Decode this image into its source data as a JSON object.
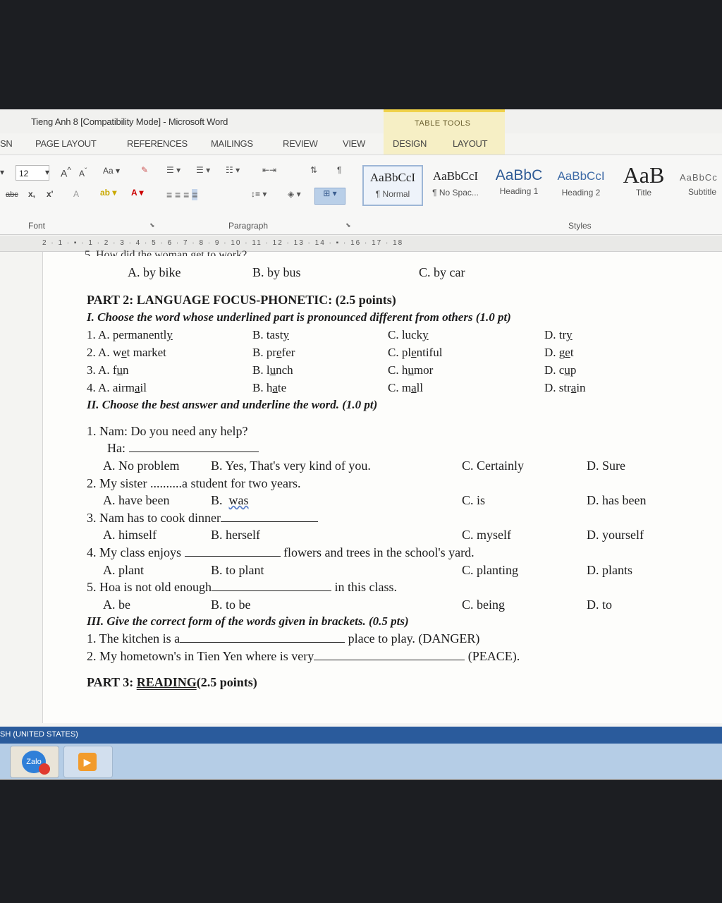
{
  "window": {
    "title": "Tieng Anh 8 [Compatibility Mode] - Microsoft Word",
    "context_tab_group": "TABLE TOOLS"
  },
  "tabs": [
    "SN",
    "PAGE LAYOUT",
    "REFERENCES",
    "MAILINGS",
    "REVIEW",
    "VIEW",
    "DESIGN",
    "LAYOUT"
  ],
  "ribbon": {
    "font_size": "12",
    "group_font": "Font",
    "group_paragraph": "Paragraph",
    "group_styles": "Styles",
    "styles": [
      {
        "sample": "AaBbCcI",
        "name": "¶ Normal"
      },
      {
        "sample": "AaBbCcI",
        "name": "¶ No Spac..."
      },
      {
        "sample": "AaBbC",
        "name": "Heading 1"
      },
      {
        "sample": "AaBbCcI",
        "name": "Heading 2"
      },
      {
        "sample": "AaB",
        "name": "Title"
      },
      {
        "sample": "AaBbCc",
        "name": "Subtitle"
      }
    ]
  },
  "ruler": {
    "marks": "2 · 1 · ▪ · 1 · 2 · 3 · 4 · 5 · 6 · 7 · 8 · 9 · 10 · 11 · 12 · 13 · 14 · ▪ · 16 · 17 · 18"
  },
  "document": {
    "prev_options": {
      "a": "A. by bike",
      "b": "B. by bus",
      "c": "C. by car"
    },
    "part2_title": "PART 2: LANGUAGE FOCUS-PHONETIC: (2.5 points)",
    "sec1_title": "I. Choose the word whose underlined part is pronounced different from others (1.0 pt)",
    "sec1_rows": [
      {
        "a": "1. A. permanently",
        "b": "B. tasty",
        "c": "C. lucky",
        "d": "D. try"
      },
      {
        "a": "2. A. wet market",
        "b": "B. prefer",
        "c": "C. plentiful",
        "d": "D. get"
      },
      {
        "a": "3. A. fun",
        "b": "B. lunch",
        "c": "C. humor",
        "d": "D. cup"
      },
      {
        "a": "4. A. airmail",
        "b": "B. hate",
        "c": "C. mall",
        "d": "D. strain"
      }
    ],
    "sec2_title": "II. Choose the best answer and underline the word. (1.0 pt)",
    "q1": {
      "line1": "1. Nam: Do you need any help?",
      "line2": "Ha:",
      "a": "A. No problem",
      "b": "B. Yes, That's very kind of you.",
      "c": "C. Certainly",
      "d": "D. Sure"
    },
    "q2": {
      "pre": "2. My sister ",
      "dots": "..........",
      "post": "a student for two years.",
      "a": "A. have been",
      "b": "B.",
      "b_word": "was",
      "c": "C. is",
      "d": "D. has been"
    },
    "q3": {
      "text": "3. Nam has to cook dinner",
      "a": "A. himself",
      "b": "B. herself",
      "c": "C. myself",
      "d": "D. yourself"
    },
    "q4": {
      "pre": "4. My class enjoys",
      "post": "flowers and trees in the school's yard.",
      "a": "A. plant",
      "b": "B. to plant",
      "c": "C. planting",
      "d": "D. plants"
    },
    "q5": {
      "pre": "5. Hoa is not old enough",
      "post": "in this class.",
      "a": "A. be",
      "b": "B. to be",
      "c": "C. being",
      "d": "D. to"
    },
    "sec3_title": "III. Give the correct form of the words given in brackets. (0.5 pts)",
    "s3q1": {
      "pre": "1. The kitchen is a",
      "post": "place to play. (DANGER)"
    },
    "s3q2": {
      "pre": "2. My hometown's in Tien Yen where is very",
      "post": "(PEACE)."
    },
    "part3": {
      "prefix": "PART 3: ",
      "word": "READING",
      "suffix": "(2.5 points)"
    }
  },
  "statusbar": {
    "language": "SH (UNITED STATES)"
  },
  "taskbar": {
    "apps": [
      "zalo-icon",
      "media-player-icon"
    ]
  }
}
